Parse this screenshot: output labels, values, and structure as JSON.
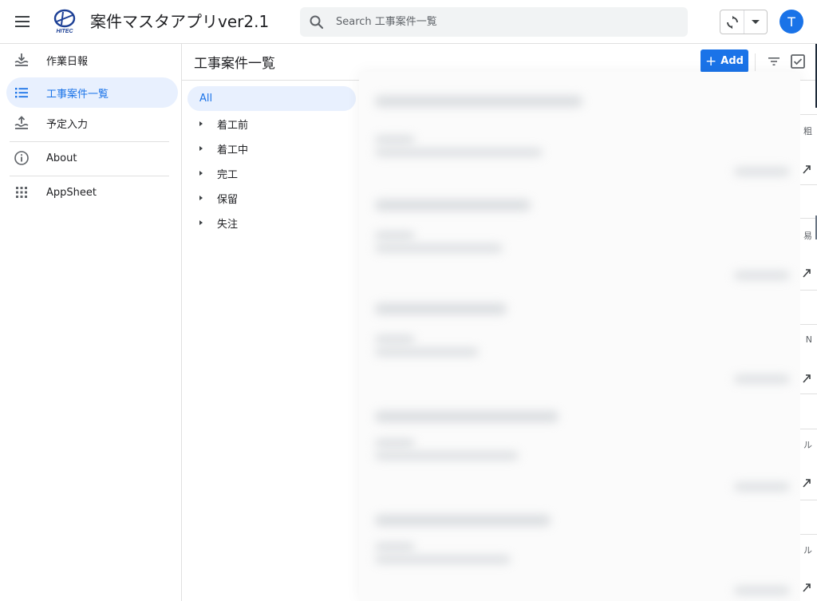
{
  "app": {
    "title": "案件マスタアプリver2.1",
    "logo_text": "HITEC",
    "search_placeholder": "Search 工事案件一覧",
    "avatar_initial": "T"
  },
  "nav": {
    "items": [
      {
        "label": "作業日報",
        "icon": "download-tray-icon",
        "active": false
      },
      {
        "label": "工事案件一覧",
        "icon": "list-icon",
        "active": true
      },
      {
        "label": "予定入力",
        "icon": "upload-tray-icon",
        "active": false
      },
      {
        "label": "About",
        "icon": "info-icon",
        "active": false
      },
      {
        "label": "AppSheet",
        "icon": "grid-apps-icon",
        "active": false
      }
    ]
  },
  "view": {
    "title": "工事案件一覧",
    "add_label": "Add"
  },
  "groups": {
    "all_label": "All",
    "items": [
      "着工前",
      "着工中",
      "完工",
      "保留",
      "失注"
    ]
  },
  "sliver": {
    "chars": [
      "粗",
      "易",
      "N",
      "ル",
      "ル"
    ]
  },
  "colors": {
    "accent": "#1a73e8",
    "active_bg": "#e8f0fe",
    "divider": "#e0e0e0"
  }
}
